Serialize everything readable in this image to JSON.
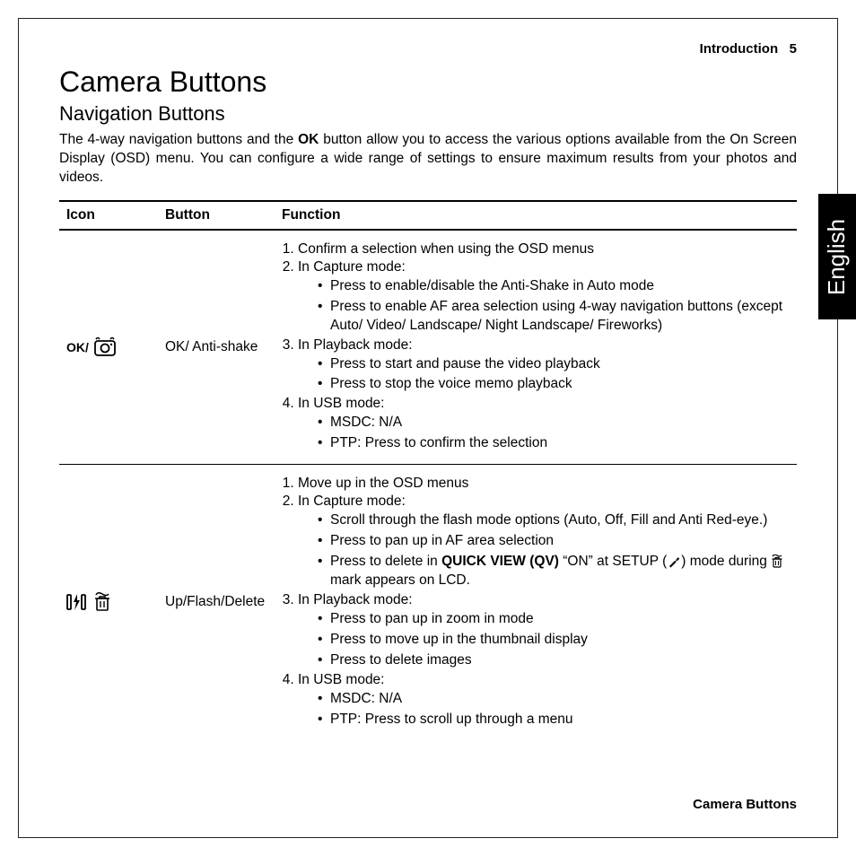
{
  "header": {
    "section": "Introduction",
    "page": "5"
  },
  "title": "Camera Buttons",
  "subtitle": "Navigation Buttons",
  "intro_pre": "The 4-way navigation buttons and the ",
  "intro_bold": "OK",
  "intro_post": " button allow you to access the various options available from the On Screen Display (OSD) menu. You can configure a wide range of settings to ensure maximum results from your photos and videos.",
  "table": {
    "headers": {
      "icon": "Icon",
      "button": "Button",
      "function": "Function"
    },
    "rows": [
      {
        "icon_label_prefix": "OK/",
        "button": "OK/ Anti-shake",
        "items": [
          {
            "type": "li",
            "text": "Confirm a selection when using the OSD menus"
          },
          {
            "type": "li",
            "text": "In Capture mode:",
            "sub": [
              "Press to enable/disable the Anti-Shake in Auto mode",
              "Press to enable AF area selection using 4-way navigation buttons (except Auto/ Video/ Landscape/ Night Landscape/ Fireworks)"
            ]
          },
          {
            "type": "li",
            "text": "In Playback mode:",
            "sub": [
              "Press to start and pause the video playback",
              "Press to stop the voice memo playback"
            ]
          },
          {
            "type": "li",
            "text": "In USB mode:",
            "sub": [
              "MSDC: N/A",
              "PTP: Press to confirm the selection"
            ]
          }
        ]
      },
      {
        "button": "Up/Flash/Delete",
        "items": [
          {
            "type": "li",
            "text": "Move up in the OSD menus"
          },
          {
            "type": "li",
            "text": "In Capture mode:",
            "sub": [
              "Scroll through the flash mode options (Auto, Off, Fill and Anti Red-eye.)",
              "Press to pan up in AF area selection",
              {
                "rich": true,
                "pre": "Press to delete in ",
                "bold1": "QUICK VIEW (QV)",
                "mid1": " “ON” at SETUP (",
                "wrench": true,
                "mid2": ") mode during ",
                "trash": true,
                "post": " mark appears on LCD."
              }
            ]
          },
          {
            "type": "li",
            "text": "In Playback mode:",
            "sub": [
              "Press to pan up in zoom in mode",
              "Press to move up in the thumbnail display",
              "Press to delete images"
            ]
          },
          {
            "type": "li",
            "text": "In USB mode:",
            "sub": [
              "MSDC: N/A",
              "PTP: Press to scroll up through a menu"
            ]
          }
        ]
      }
    ]
  },
  "footer": "Camera Buttons",
  "language_tab": "English"
}
